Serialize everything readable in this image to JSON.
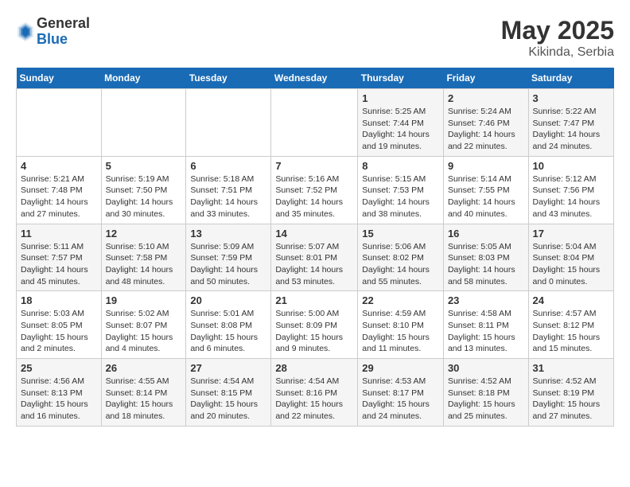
{
  "logo": {
    "general": "General",
    "blue": "Blue"
  },
  "title": "May 2025",
  "subtitle": "Kikinda, Serbia",
  "weekdays": [
    "Sunday",
    "Monday",
    "Tuesday",
    "Wednesday",
    "Thursday",
    "Friday",
    "Saturday"
  ],
  "weeks": [
    [
      {
        "day": "",
        "info": ""
      },
      {
        "day": "",
        "info": ""
      },
      {
        "day": "",
        "info": ""
      },
      {
        "day": "",
        "info": ""
      },
      {
        "day": "1",
        "info": "Sunrise: 5:25 AM\nSunset: 7:44 PM\nDaylight: 14 hours\nand 19 minutes."
      },
      {
        "day": "2",
        "info": "Sunrise: 5:24 AM\nSunset: 7:46 PM\nDaylight: 14 hours\nand 22 minutes."
      },
      {
        "day": "3",
        "info": "Sunrise: 5:22 AM\nSunset: 7:47 PM\nDaylight: 14 hours\nand 24 minutes."
      }
    ],
    [
      {
        "day": "4",
        "info": "Sunrise: 5:21 AM\nSunset: 7:48 PM\nDaylight: 14 hours\nand 27 minutes."
      },
      {
        "day": "5",
        "info": "Sunrise: 5:19 AM\nSunset: 7:50 PM\nDaylight: 14 hours\nand 30 minutes."
      },
      {
        "day": "6",
        "info": "Sunrise: 5:18 AM\nSunset: 7:51 PM\nDaylight: 14 hours\nand 33 minutes."
      },
      {
        "day": "7",
        "info": "Sunrise: 5:16 AM\nSunset: 7:52 PM\nDaylight: 14 hours\nand 35 minutes."
      },
      {
        "day": "8",
        "info": "Sunrise: 5:15 AM\nSunset: 7:53 PM\nDaylight: 14 hours\nand 38 minutes."
      },
      {
        "day": "9",
        "info": "Sunrise: 5:14 AM\nSunset: 7:55 PM\nDaylight: 14 hours\nand 40 minutes."
      },
      {
        "day": "10",
        "info": "Sunrise: 5:12 AM\nSunset: 7:56 PM\nDaylight: 14 hours\nand 43 minutes."
      }
    ],
    [
      {
        "day": "11",
        "info": "Sunrise: 5:11 AM\nSunset: 7:57 PM\nDaylight: 14 hours\nand 45 minutes."
      },
      {
        "day": "12",
        "info": "Sunrise: 5:10 AM\nSunset: 7:58 PM\nDaylight: 14 hours\nand 48 minutes."
      },
      {
        "day": "13",
        "info": "Sunrise: 5:09 AM\nSunset: 7:59 PM\nDaylight: 14 hours\nand 50 minutes."
      },
      {
        "day": "14",
        "info": "Sunrise: 5:07 AM\nSunset: 8:01 PM\nDaylight: 14 hours\nand 53 minutes."
      },
      {
        "day": "15",
        "info": "Sunrise: 5:06 AM\nSunset: 8:02 PM\nDaylight: 14 hours\nand 55 minutes."
      },
      {
        "day": "16",
        "info": "Sunrise: 5:05 AM\nSunset: 8:03 PM\nDaylight: 14 hours\nand 58 minutes."
      },
      {
        "day": "17",
        "info": "Sunrise: 5:04 AM\nSunset: 8:04 PM\nDaylight: 15 hours\nand 0 minutes."
      }
    ],
    [
      {
        "day": "18",
        "info": "Sunrise: 5:03 AM\nSunset: 8:05 PM\nDaylight: 15 hours\nand 2 minutes."
      },
      {
        "day": "19",
        "info": "Sunrise: 5:02 AM\nSunset: 8:07 PM\nDaylight: 15 hours\nand 4 minutes."
      },
      {
        "day": "20",
        "info": "Sunrise: 5:01 AM\nSunset: 8:08 PM\nDaylight: 15 hours\nand 6 minutes."
      },
      {
        "day": "21",
        "info": "Sunrise: 5:00 AM\nSunset: 8:09 PM\nDaylight: 15 hours\nand 9 minutes."
      },
      {
        "day": "22",
        "info": "Sunrise: 4:59 AM\nSunset: 8:10 PM\nDaylight: 15 hours\nand 11 minutes."
      },
      {
        "day": "23",
        "info": "Sunrise: 4:58 AM\nSunset: 8:11 PM\nDaylight: 15 hours\nand 13 minutes."
      },
      {
        "day": "24",
        "info": "Sunrise: 4:57 AM\nSunset: 8:12 PM\nDaylight: 15 hours\nand 15 minutes."
      }
    ],
    [
      {
        "day": "25",
        "info": "Sunrise: 4:56 AM\nSunset: 8:13 PM\nDaylight: 15 hours\nand 16 minutes."
      },
      {
        "day": "26",
        "info": "Sunrise: 4:55 AM\nSunset: 8:14 PM\nDaylight: 15 hours\nand 18 minutes."
      },
      {
        "day": "27",
        "info": "Sunrise: 4:54 AM\nSunset: 8:15 PM\nDaylight: 15 hours\nand 20 minutes."
      },
      {
        "day": "28",
        "info": "Sunrise: 4:54 AM\nSunset: 8:16 PM\nDaylight: 15 hours\nand 22 minutes."
      },
      {
        "day": "29",
        "info": "Sunrise: 4:53 AM\nSunset: 8:17 PM\nDaylight: 15 hours\nand 24 minutes."
      },
      {
        "day": "30",
        "info": "Sunrise: 4:52 AM\nSunset: 8:18 PM\nDaylight: 15 hours\nand 25 minutes."
      },
      {
        "day": "31",
        "info": "Sunrise: 4:52 AM\nSunset: 8:19 PM\nDaylight: 15 hours\nand 27 minutes."
      }
    ]
  ]
}
